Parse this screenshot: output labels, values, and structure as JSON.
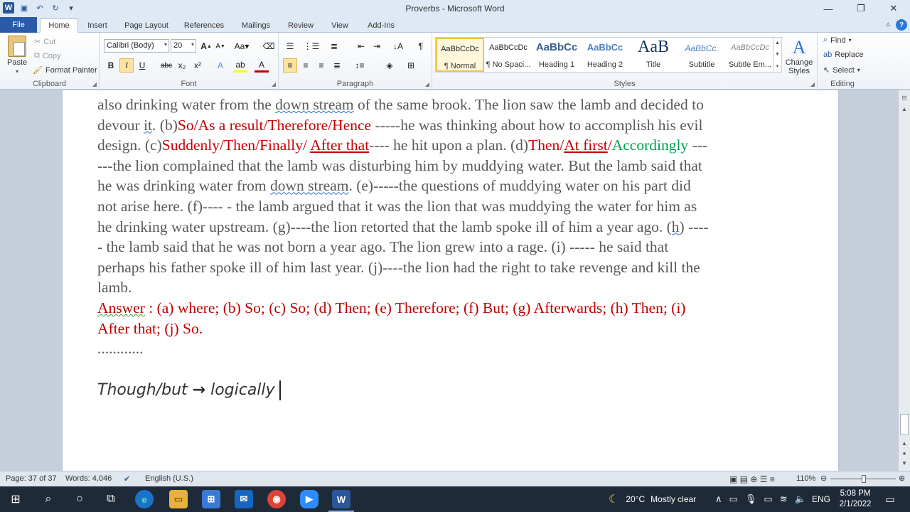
{
  "window": {
    "title": "Proverbs  -  Microsoft Word",
    "controls": [
      "—",
      "❐",
      "✕"
    ]
  },
  "tabs": [
    "File",
    "Home",
    "Insert",
    "Page Layout",
    "References",
    "Mailings",
    "Review",
    "View",
    "Add-Ins"
  ],
  "clipboard": {
    "paste": "Paste",
    "cut": "Cut",
    "copy": "Copy",
    "format_painter": "Format Painter",
    "label": "Clipboard"
  },
  "font": {
    "name": "Calibri (Body)",
    "size": "20",
    "label": "Font",
    "buttons": [
      "B",
      "I",
      "U",
      "abc",
      "x₂",
      "x²"
    ]
  },
  "paragraph": {
    "label": "Paragraph"
  },
  "styles": {
    "label": "Styles",
    "items": [
      {
        "preview": "AaBbCcDc",
        "name": "¶ Normal"
      },
      {
        "preview": "AaBbCcDc",
        "name": "¶ No Spaci..."
      },
      {
        "preview": "AaBbCc",
        "name": "Heading 1"
      },
      {
        "preview": "AaBbCc",
        "name": "Heading 2"
      },
      {
        "preview": "AaB",
        "name": "Title"
      },
      {
        "preview": "AaBbCc.",
        "name": "Subtitle"
      },
      {
        "preview": "AaBbCcDc",
        "name": "Subtle Em..."
      }
    ],
    "change_styles": "Change Styles"
  },
  "editing": {
    "label": "Editing",
    "find": "Find",
    "replace": "Replace",
    "select": "Select"
  },
  "document": {
    "l1": "also drinking water from the ",
    "l1_w": "down stream",
    "l1_b": " of the same brook. The lion saw the lamb and decided to",
    "l2a": "devour ",
    "l2_w": "it",
    "l2b": ". (b)",
    "l2_r": "So/As a result/Therefore/Hence",
    "l2c": " -----he was thinking about how to accomplish his evil",
    "l3a": "design. (c)",
    "l3_r1": "Suddenly/Then/Finally/ ",
    "l3_r2": "After that",
    "l3b": "---- he hit upon a plan. (d)",
    "l3_r3": "Then/",
    "l3_r4": "At first",
    "l3_r5": "/",
    "l3_g": "Accordingly",
    "l3c": " ---",
    "l4": "---the lion complained that the lamb was disturbing him by muddying water. But the lamb said that",
    "l5a": "he was drinking water from ",
    "l5_w": "down stream",
    "l5b": ". (e)-----the questions of muddying water on his part did",
    "l6": "not arise here. (f)---- - the lamb argued that it was the lion that was muddying the water for him as",
    "l7a": "he drinking water upstream. (g)----the lion retorted that the lamb spoke ill of him a year ago. (",
    "l7_w": "h",
    "l7b": ") ----",
    "l8": "- the lamb said that he was not born a year ago. The lion grew into a rage. (i) ----- he said that",
    "l9": "perhaps his father spoke ill of him last year. (j)----the lion had the right to take revenge and kill the",
    "l10": "lamb.",
    "ans_label": "Answer",
    "ans1": " : (a) where; (b) So; (c) So; (d) Then; (e) Therefore; (f) But; (g) Afterwards; (h) Then; (i)",
    "ans2": "After that; (j) So.",
    "dots": "............",
    "hand_a": "Though/but",
    "hand_arrow": "→",
    "hand_b": "logically"
  },
  "status": {
    "page": "Page: 37 of 37",
    "words": "Words: 4,046",
    "language": "English (U.S.)",
    "zoom": "110%"
  },
  "taskbar": {
    "temperature": "20°C",
    "weather": "Mostly clear",
    "lang": "ENG",
    "time": "5:08 PM",
    "date": "2/1/2022"
  }
}
